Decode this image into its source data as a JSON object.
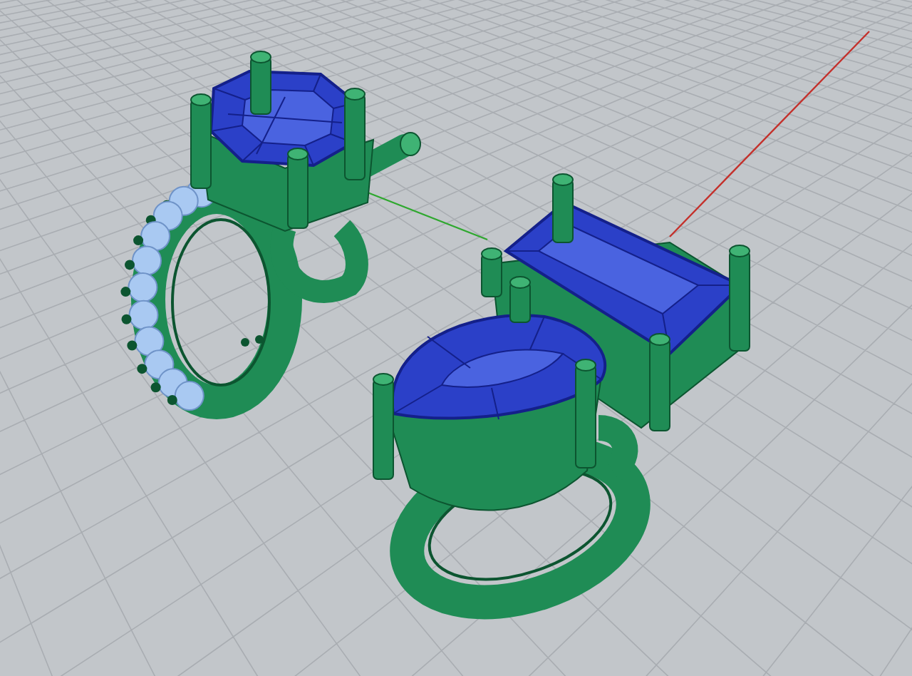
{
  "viewport": {
    "grid": true,
    "axes": true
  },
  "models": [
    {
      "kind": "eternity-band"
    },
    {
      "kind": "octagon-stone-ring"
    },
    {
      "kind": "pear-and-baguette-ring"
    }
  ]
}
